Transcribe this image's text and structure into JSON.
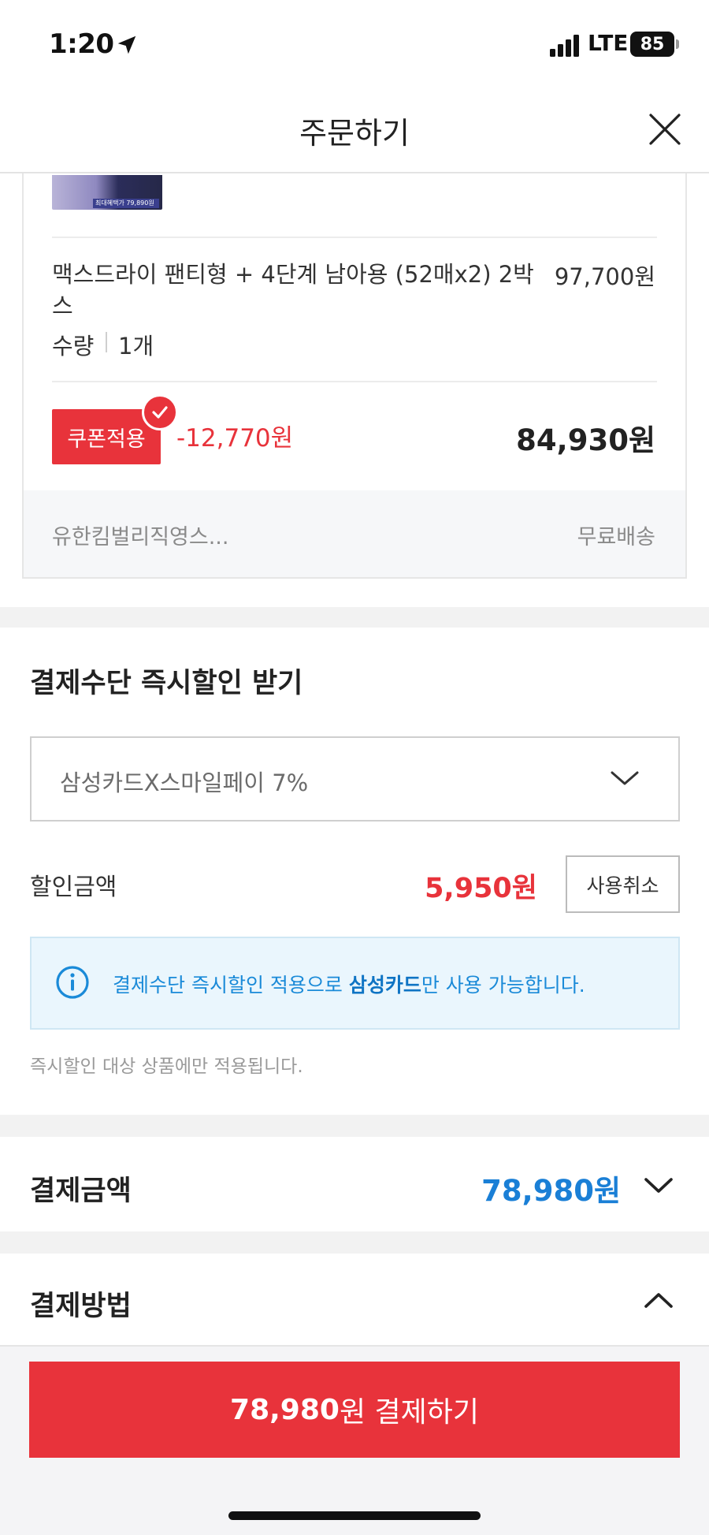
{
  "status_bar": {
    "time": "1:20",
    "network": "LTE",
    "battery": "85"
  },
  "header": {
    "title": "주문하기"
  },
  "product": {
    "thumbnail_tag": "최대혜택가 79,890원",
    "name": "맥스드라이 팬티형 + 4단계 남아용 (52매x2) 2박스",
    "price": "97,700원",
    "qty_label": "수량",
    "qty_value": "1개",
    "coupon_label": "쿠폰적용",
    "coupon_discount": "-12,770원",
    "final_price": "84,930원",
    "seller": "유한킴벌리직영스...",
    "shipping": "무료배송"
  },
  "instant_discount": {
    "title": "결제수단 즉시할인 받기",
    "selected_option": "삼성카드X스마일페이 7%",
    "discount_label": "할인금액",
    "discount_amount": "5,950원",
    "cancel_label": "사용취소",
    "info_prefix": "결제수단 즉시할인 적용으로 ",
    "info_bold": "삼성카드",
    "info_suffix": "만 사용 가능합니다.",
    "note": "즉시할인 대상 상품에만 적용됩니다."
  },
  "payment_amount": {
    "label": "결제금액",
    "value": "78,980원"
  },
  "payment_method": {
    "label": "결제방법"
  },
  "pay_button": {
    "amount": "78,980",
    "suffix": "원 결제하기"
  },
  "colors": {
    "accent_red": "#e8333b",
    "accent_blue": "#1a7fd6",
    "info_bg": "#eaf6fd"
  },
  "icons": [
    "location-arrow-icon",
    "signal-icon",
    "battery-icon",
    "close-icon",
    "check-icon",
    "chevron-down-icon",
    "info-icon",
    "chevron-up-icon"
  ]
}
